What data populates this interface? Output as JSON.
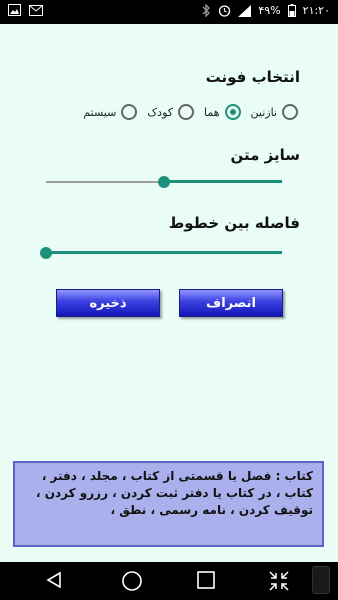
{
  "status_bar": {
    "time": "۲۱:۲۰",
    "battery": "۴۹%",
    "icons": [
      "image-icon",
      "mail-icon",
      "bluetooth-icon",
      "alarm-icon",
      "signal-icon",
      "battery-icon"
    ]
  },
  "font": {
    "title": "انتخاب فونت",
    "options": [
      "نازنین",
      "هما",
      "کودک",
      "سیستم"
    ],
    "selected": "هما"
  },
  "size": {
    "title": "سایز متن",
    "value": 0.5
  },
  "spacing": {
    "title": "فاصله بین خطوط",
    "value": 1.0
  },
  "buttons": {
    "cancel": "انصراف",
    "save": "ذخیره"
  },
  "sample_text": "کتاب : فصل یا قسمتی از کتاب ، مجلد ، دفتر ، کتاب ، در کتاب یا دفتر ثبت کردن ، رزرو کردن ، توقیف کردن ، نامه رسمی ، نطق ،",
  "colors": {
    "accent": "#1e8f7a",
    "background": "#e9fdf6",
    "button_blue": "#1f25c8",
    "sample_box": "#aab0ec"
  },
  "nav_bar": {
    "icons": [
      "back-icon",
      "home-icon",
      "recents-icon",
      "screen-shrink-icon"
    ]
  }
}
